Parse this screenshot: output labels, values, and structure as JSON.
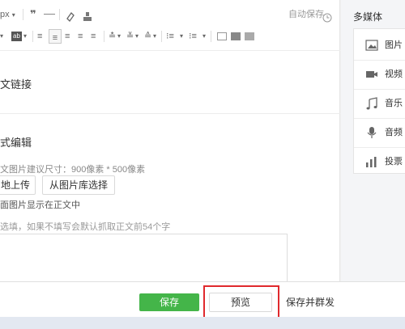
{
  "toolbar": {
    "font_size": "px",
    "autosave_label": "自动保存"
  },
  "sections": {
    "link_label": "文链接",
    "editor_label": "式编辑",
    "cover_hint": "文图片建议尺寸：900像素 * 500像素",
    "upload_button": "地上传",
    "library_button": "从图片库选择",
    "show_in_body": "面图片显示在正文中",
    "summary_hint": "选填，如果不填写会默认抓取正文前54个字"
  },
  "media_panel": {
    "title": "多媒体",
    "items": [
      {
        "label": "图片",
        "icon": "image-icon"
      },
      {
        "label": "视频",
        "icon": "video-icon"
      },
      {
        "label": "音乐",
        "icon": "music-icon"
      },
      {
        "label": "音频",
        "icon": "microphone-icon"
      },
      {
        "label": "投票",
        "icon": "poll-icon"
      }
    ]
  },
  "actions": {
    "save": "保存",
    "preview": "预览",
    "save_publish": "保存并群发"
  },
  "colors": {
    "primary_green": "#44b549",
    "highlight_red": "#e0292d"
  }
}
